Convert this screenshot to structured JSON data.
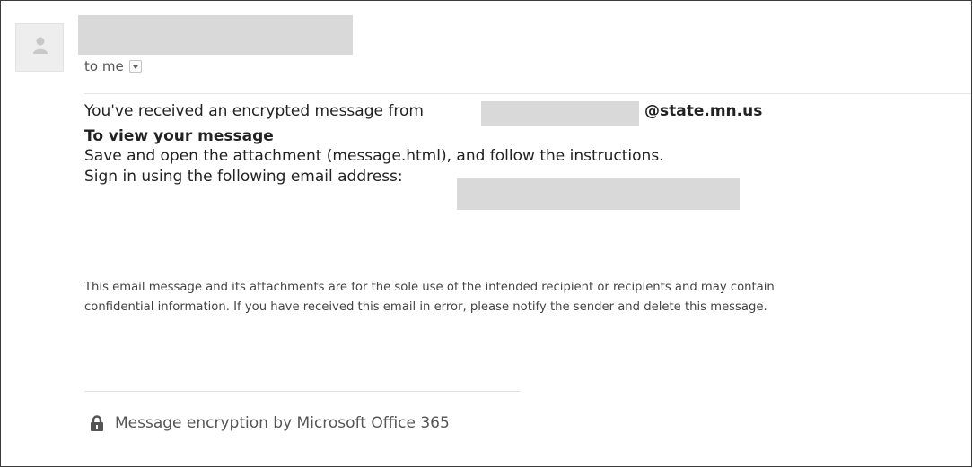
{
  "header": {
    "to_label": "to me"
  },
  "message": {
    "received_text": "You've received an encrypted message from ",
    "sender_domain": "@state.mn.us",
    "view_heading": "To view your message",
    "instructions": "Save and open the attachment (message.html), and follow the instructions.",
    "signin_text": "Sign in using the following email address:"
  },
  "disclaimer": {
    "line1": "This email message and its attachments are for the sole use of the intended recipient or recipients and may contain",
    "line2": "confidential information. If you have received this email in error, please notify the sender and delete this message."
  },
  "footer": {
    "icon": "lock-icon",
    "text": "Message encryption by Microsoft Office 365"
  },
  "colors": {
    "redaction": "#d9d9d9",
    "text": "#222222"
  }
}
